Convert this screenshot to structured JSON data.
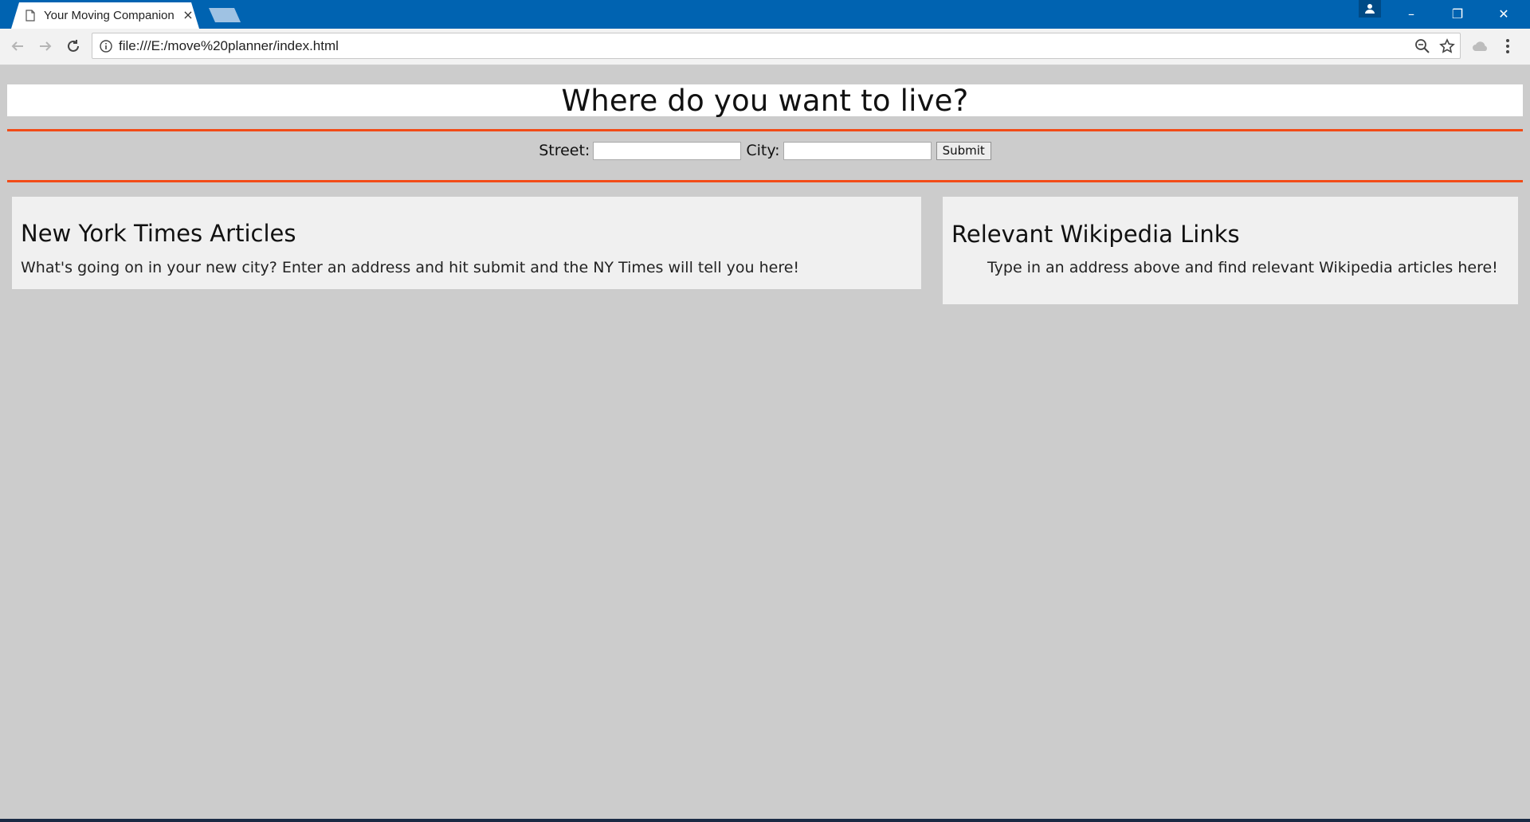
{
  "browser": {
    "tab_title": "Your Moving Companion",
    "tab_close": "×",
    "url": "file:///E:/move%20planner/index.html",
    "icons": {
      "back": "back-arrow-icon",
      "forward": "forward-arrow-icon",
      "reload": "reload-icon",
      "info": "info-icon",
      "zoom": "zoom-icon",
      "bookmark": "star-icon",
      "extension": "cloud-icon",
      "menu": "kebab-menu-icon"
    },
    "window_controls": {
      "minimize": "–",
      "restore": "❐",
      "close": "✕"
    }
  },
  "page": {
    "headline": "Where do you want to live?",
    "form": {
      "street_label": "Street:",
      "street_value": "",
      "city_label": "City:",
      "city_value": "",
      "submit_label": "Submit"
    },
    "nyt": {
      "heading": "New York Times Articles",
      "text": "What's going on in your new city? Enter an address and hit submit and the NY Times will tell you here!"
    },
    "wiki": {
      "heading": "Relevant Wikipedia Links",
      "text": "Type in an address above and find relevant Wikipedia articles here!"
    }
  },
  "colors": {
    "titlebar": "#0063b1",
    "accent_rule": "#f24b17",
    "page_background": "#cccccc",
    "card_background": "#f0f0f0"
  }
}
